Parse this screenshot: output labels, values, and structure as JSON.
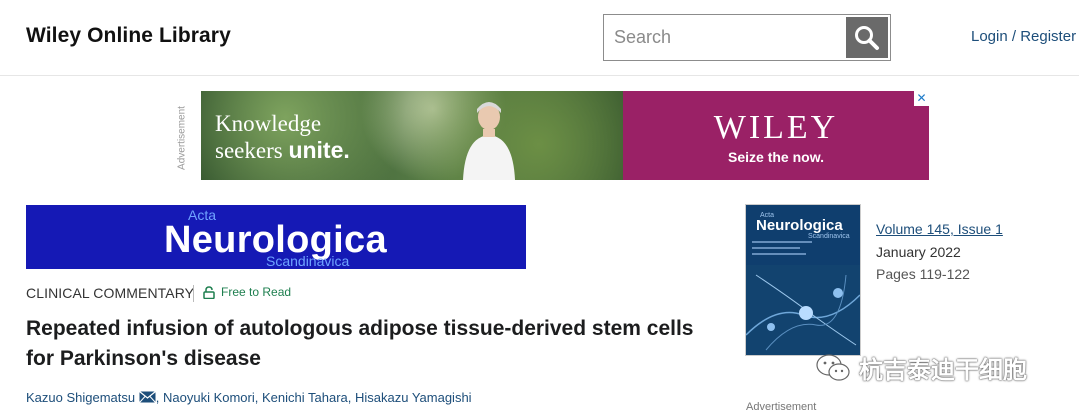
{
  "header": {
    "brand": "Wiley Online Library",
    "search_placeholder": "Search",
    "login_label": "Login / Register"
  },
  "ad": {
    "side_label": "Advertisement",
    "line1": "Knowledge",
    "line2_a": "seekers ",
    "line2_b": "unite.",
    "brand": "WILEY",
    "tagline": "Seize the now.",
    "close": "✕"
  },
  "journal_banner": {
    "acta": "Acta",
    "main": "Neurologica",
    "scandinavica": "Scandinavica"
  },
  "article": {
    "type": "CLINICAL COMMENTARY",
    "free_label": "Free to Read",
    "title": "Repeated infusion of autologous adipose tissue-derived stem cells for Parkinson's disease",
    "authors": [
      "Kazuo Shigematsu",
      "Naoyuki Komori",
      "Kenichi Tahara",
      "Hisakazu Yamagishi"
    ]
  },
  "issue": {
    "cover_acta": "Acta",
    "cover_title": "Neurologica",
    "cover_scand": "Scandinavica",
    "volume_issue": "Volume 145, Issue 1",
    "date": "January 2022",
    "pages": "Pages 119-122",
    "advertisement_label": "Advertisement"
  },
  "watermark": {
    "text": "杭吉泰迪干细胞"
  },
  "colors": {
    "link": "#1d4e7a",
    "ad_magenta": "#9a2166",
    "journal_blue": "#1519b5",
    "free_green": "#1e7f4f",
    "search_button": "#6a6a6a"
  }
}
